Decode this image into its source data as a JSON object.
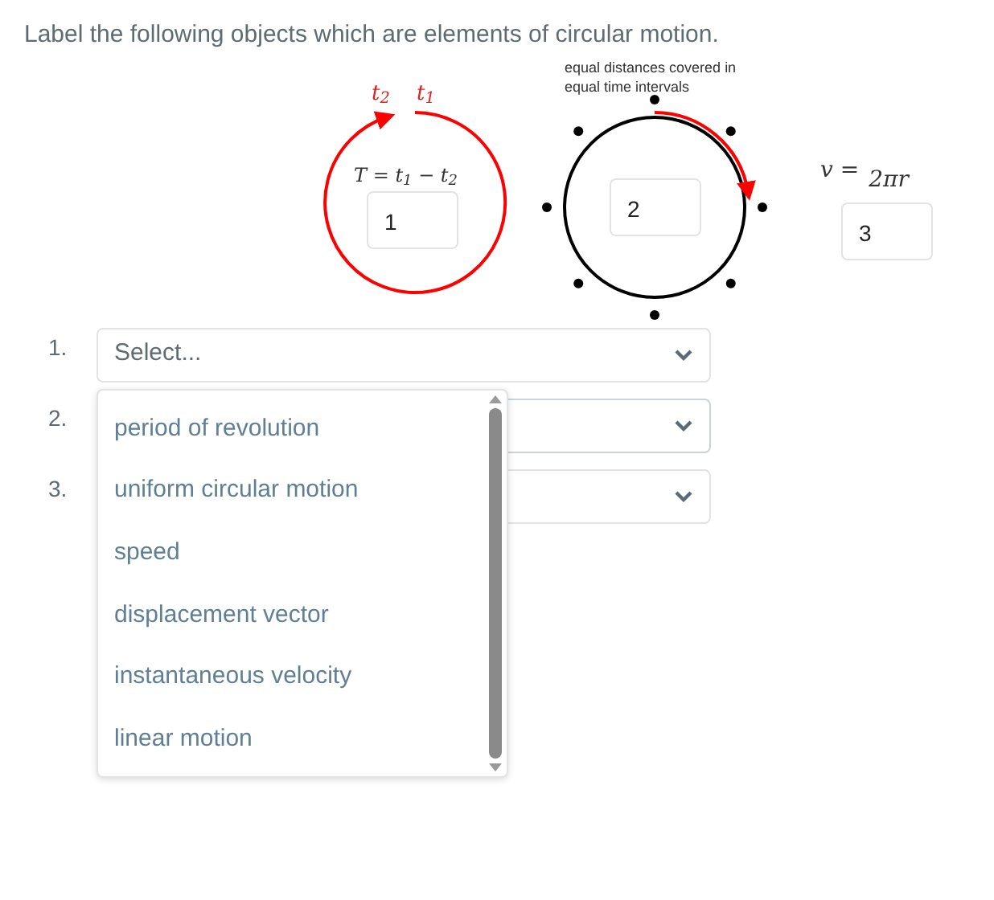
{
  "instruction": "Label the following objects which are elements of circular motion.",
  "figure": {
    "period_labels": [
      "t$_{2}$",
      "t$_{1}$"
    ],
    "period_formula": "T = t$_{1}$ − t$_{2}$",
    "caption": "equal distances covered in equal time intervals",
    "speed_formula_left": "v =",
    "speed_formula_numerator": "2πr",
    "answer_boxes": [
      "1",
      "2",
      "3"
    ]
  },
  "questions": [
    {
      "number": "1.",
      "placeholder": "Select...",
      "expanded": false
    },
    {
      "number": "2.",
      "expanded": true
    },
    {
      "number": "3.",
      "expanded": false
    }
  ],
  "options": [
    {
      "label": "period of revolution",
      "selected": false
    },
    {
      "label": "uniform circular motion",
      "selected": false
    },
    {
      "label": "speed",
      "selected": false
    },
    {
      "label": "displacement vector",
      "selected": false
    },
    {
      "label": "instantaneous velocity",
      "selected": false
    },
    {
      "label": "linear motion",
      "selected": false
    }
  ]
}
